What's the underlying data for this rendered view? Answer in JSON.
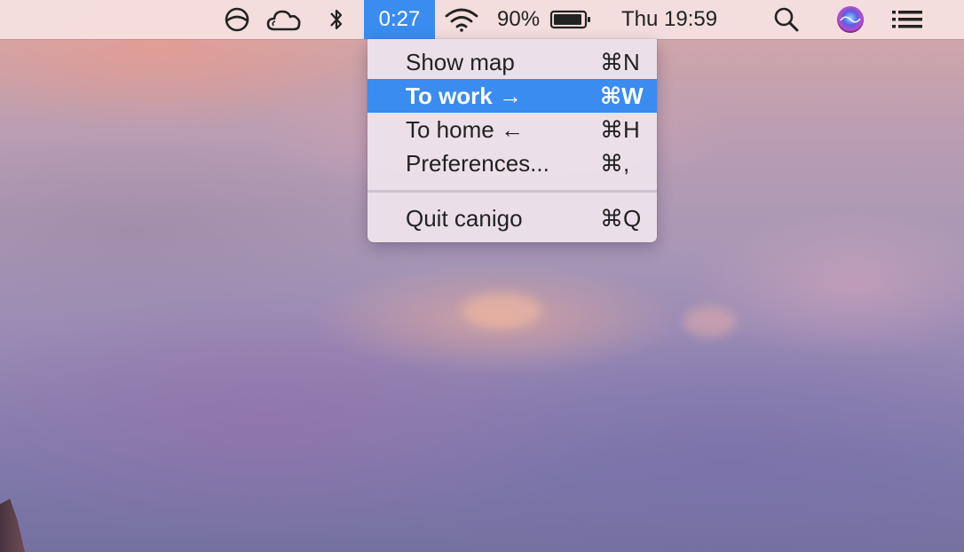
{
  "menubar": {
    "timer": "0:27",
    "battery_percent": "90%",
    "clock": "Thu 19:59",
    "icons": [
      "app-circle-icon",
      "cloud-icon",
      "bluetooth-icon",
      "wifi-icon",
      "battery-icon",
      "spotlight-search-icon",
      "siri-icon",
      "notification-center-icon"
    ]
  },
  "menu": {
    "items": [
      {
        "label": "Show map",
        "shortcut": "⌘N"
      },
      {
        "label": "To work →",
        "shortcut": "⌘W"
      },
      {
        "label": "To home ←",
        "shortcut": "⌘H"
      },
      {
        "label": "Preferences...",
        "shortcut": "⌘,"
      },
      {
        "label": "Quit canigo",
        "shortcut": "⌘Q"
      }
    ],
    "selected_index": 1
  },
  "colors": {
    "highlight": "#3a8cf0",
    "menubar_bg": "#f6e2e2",
    "menu_bg": "#ece2ea"
  }
}
